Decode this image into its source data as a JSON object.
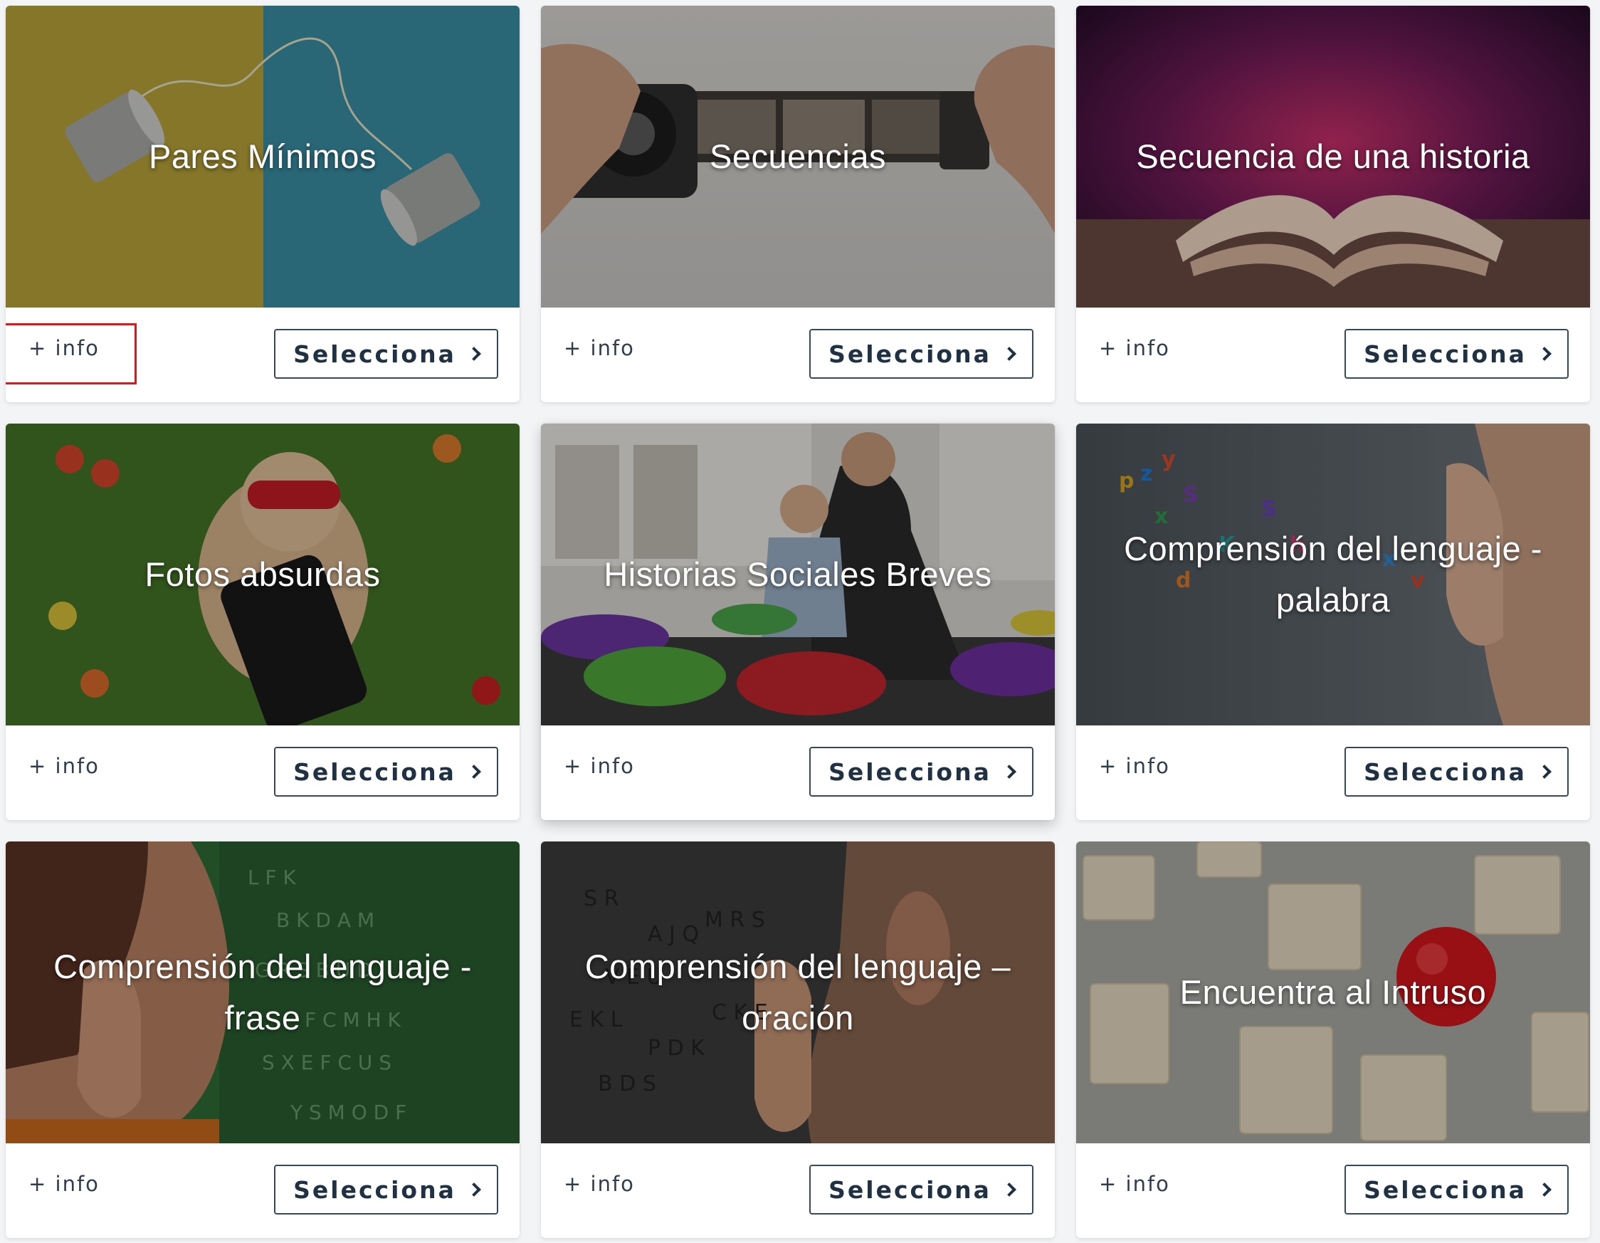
{
  "cards": [
    {
      "title": "Pares Mínimos",
      "info": "+ info",
      "button": "Selecciona"
    },
    {
      "title": "Secuencias",
      "info": "+ info",
      "button": "Selecciona"
    },
    {
      "title": "Secuencia de una historia",
      "info": "+ info",
      "button": "Selecciona"
    },
    {
      "title": "Fotos absurdas",
      "info": "+ info",
      "button": "Selecciona"
    },
    {
      "title": "Historias Sociales Breves",
      "info": "+ info",
      "button": "Selecciona"
    },
    {
      "title": "Comprensión del lenguaje - palabra",
      "info": "+ info",
      "button": "Selecciona"
    },
    {
      "title": "Comprensión del lenguaje - frase",
      "info": "+ info",
      "button": "Selecciona"
    },
    {
      "title": "Comprensión del lenguaje – oración",
      "info": "+ info",
      "button": "Selecciona"
    },
    {
      "title": "Encuentra al Intruso",
      "info": "+ info",
      "button": "Selecciona"
    }
  ],
  "colors": {
    "highlight": "#e5161b",
    "button_border": "#34495a",
    "text_dark": "#1f3142"
  }
}
